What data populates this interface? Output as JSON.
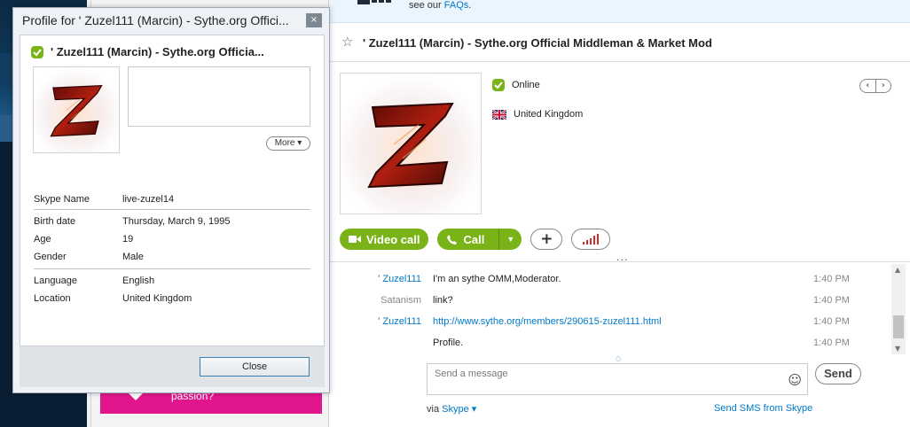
{
  "dialog": {
    "window_title": "Profile for ' Zuzel111 (Marcin) - Sythe.org Offici...",
    "close_glyph": "×",
    "display_name": "' Zuzel111 (Marcin) - Sythe.org Officia...",
    "more_label": "More ▾",
    "fields": {
      "skype_name_label": "Skype Name",
      "skype_name_value": "live-zuzel14",
      "birth_date_label": "Birth date",
      "birth_date_value": "Thursday, March 9, 1995",
      "age_label": "Age",
      "age_value": "19",
      "gender_label": "Gender",
      "gender_value": "Male",
      "language_label": "Language",
      "language_value": "English",
      "location_label": "Location",
      "location_value": "United Kingdom"
    },
    "close_button": "Close"
  },
  "faq": {
    "prefix": "see our ",
    "link": "FAQs",
    "suffix": "."
  },
  "conversation": {
    "title": "' Zuzel111 (Marcin) - Sythe.org Official Middleman & Market Mod",
    "status": "Online",
    "location": "United Kingdom",
    "pager_prev": "‹",
    "pager_next": "›",
    "video_call_label": "Video call",
    "call_label": "Call",
    "add_label": "+",
    "more_dots": "...",
    "messages": [
      {
        "sender": "' Zuzel111",
        "text": "I'm an sythe OMM,Moderator.",
        "time": "1:40 PM"
      },
      {
        "sender": "Satanism",
        "text": "link?",
        "time": "1:40 PM"
      },
      {
        "sender": "' Zuzel111",
        "text": "http://www.sythe.org/members/290615-zuzel111.html",
        "time": "1:40 PM"
      },
      {
        "sender": "",
        "text": "Profile.",
        "time": "1:40 PM"
      }
    ],
    "input_placeholder": "Send a message",
    "send_label": "Send",
    "via_prefix": "via ",
    "via_link": "Skype ▾",
    "sms_link": "Send SMS from Skype"
  },
  "promo": {
    "text": "passion?"
  },
  "colors": {
    "accent": "#0078ca",
    "green": "#7ab317",
    "promo": "#e2168c",
    "online": "#7ab317"
  }
}
